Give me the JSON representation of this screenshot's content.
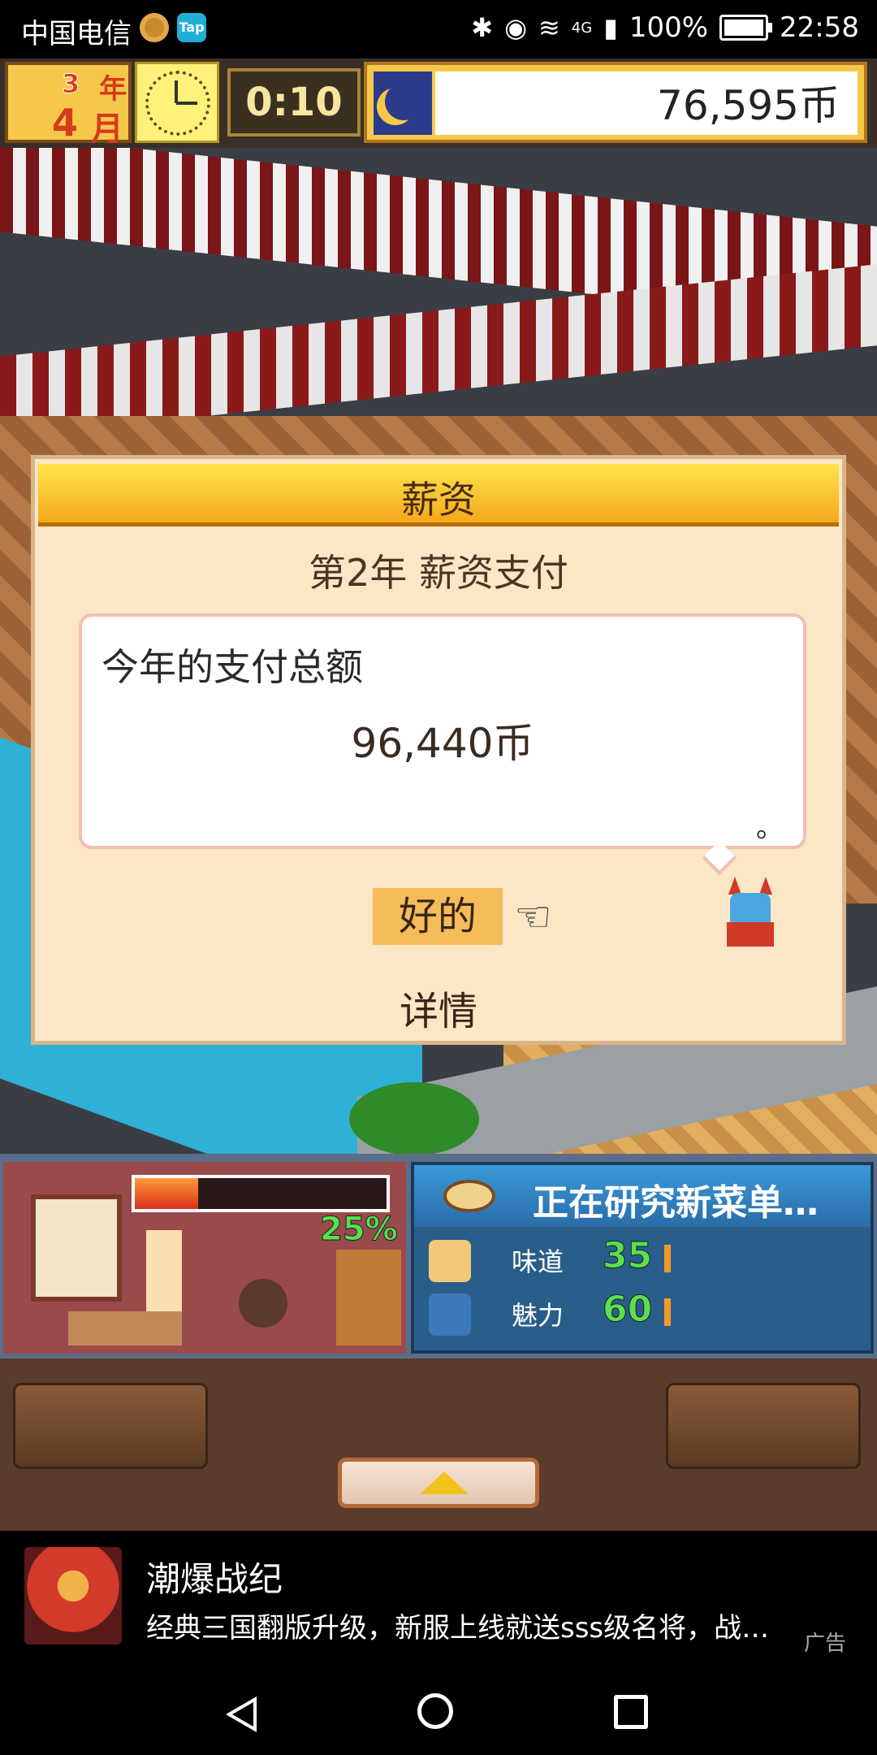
{
  "status_bar": {
    "carrier": "中国电信",
    "tap_icon_label": "Tap",
    "network": "4G",
    "battery": "100%",
    "time": "22:58"
  },
  "hud": {
    "year_number": "3",
    "year_label": "年",
    "month_number": "4",
    "month_label": "月",
    "timer": "0:10",
    "money": "76,595币"
  },
  "dialog": {
    "title": "薪资",
    "subtitle": "第2年 薪资支付",
    "bubble_label": "今年的支付总额",
    "bubble_value": "96,440币",
    "bubble_end": "。",
    "ok_button": "好的",
    "details_button": "详情"
  },
  "panel": {
    "progress_percent": 25,
    "progress_label": "25%",
    "research_header": "正在研究新菜单…",
    "stats": [
      {
        "name": "味道",
        "value": "35"
      },
      {
        "name": "魅力",
        "value": "60"
      }
    ]
  },
  "ad": {
    "title": "潮爆战纪",
    "description": "经典三国翻版升级，新服上线就送sss级名将，战…",
    "tag": "广告"
  },
  "colors": {
    "dialog_bg": "#fbe6c6",
    "header_gold": "#f2a91a",
    "ok_highlight": "#f5bc5a",
    "stat_green": "#5be04a"
  },
  "icons": [
    "clock-icon",
    "moon-icon",
    "pointing-hand-icon",
    "bluetooth-icon",
    "eye-icon",
    "wifi-icon",
    "signal-icon",
    "battery-icon"
  ]
}
